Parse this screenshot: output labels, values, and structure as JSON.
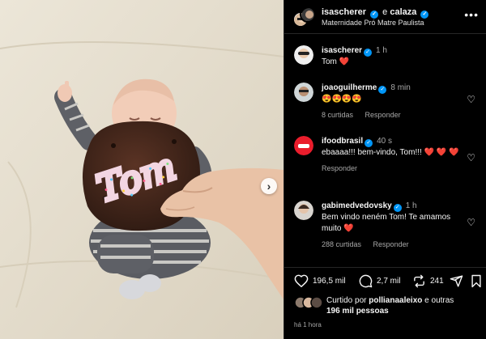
{
  "post": {
    "author_primary": "isascherer",
    "conjunction": "e",
    "author_secondary": "calaza",
    "location": "Maternidade Pró Matre Paulista",
    "more_icon": "more-horizontal-icon"
  },
  "photo": {
    "cookie_text": "Tom",
    "next_icon": "chevron-right-icon",
    "next_glyph": "›"
  },
  "comments": [
    {
      "username": "isascherer",
      "time": "1 h",
      "text": "Tom",
      "emoji": "❤️",
      "likes": "",
      "reply": ""
    },
    {
      "username": "joaoguilherme",
      "time": "8 min",
      "text": "",
      "emoji": "😍😍😍😍",
      "likes": "8 curtidas",
      "reply": "Responder"
    },
    {
      "username": "ifoodbrasil",
      "time": "40 s",
      "text": "ebaaaa!!! bem-vindo, Tom!!! ",
      "emoji": "❤️ ❤️ ❤️",
      "likes": "",
      "reply": "Responder"
    },
    {
      "username": "gabimedvedovsky",
      "time": "1 h",
      "text": "Bem vindo neném Tom! Te amamos muito ",
      "emoji": "❤️",
      "likes": "288 curtidas",
      "reply": "Responder"
    }
  ],
  "actions": {
    "likes_count": "196,5 mil",
    "comments_count": "2,7 mil",
    "reposts_count": "241"
  },
  "liked_by": {
    "prefix": "Curtido por",
    "user": "pollianaaleixo",
    "suffix": "e outras",
    "others": "196 mil pessoas"
  },
  "timestamp": "há 1 hora",
  "colors": {
    "background": "#000000",
    "verified": "#0095f6",
    "heart": "#ff3355",
    "secondary_text": "#a8a8a8"
  }
}
